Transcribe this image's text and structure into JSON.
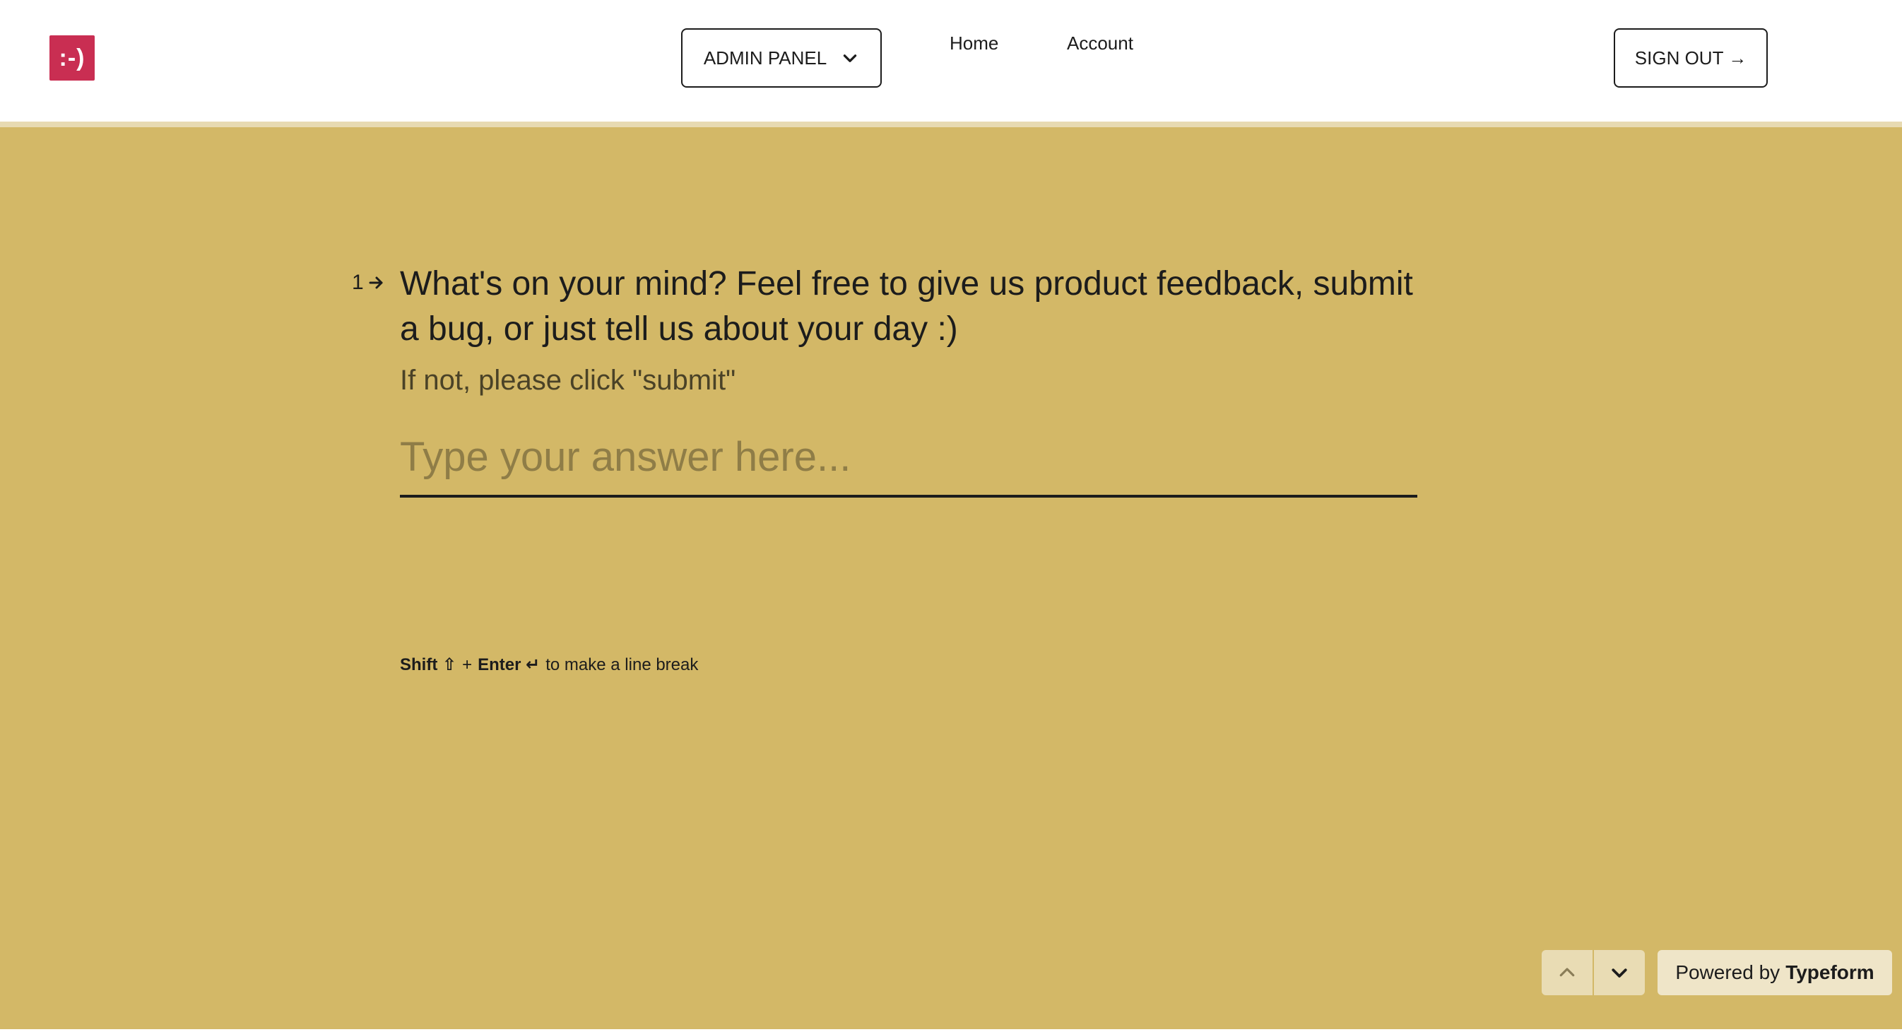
{
  "header": {
    "logo_text": ":-)",
    "admin_panel_label": "ADMIN PANEL",
    "nav": [
      {
        "label": "Home"
      },
      {
        "label": "Account"
      }
    ],
    "sign_out_label": "SIGN OUT →"
  },
  "question": {
    "number": "1",
    "title": "What's on your mind? Feel free to give us product feedback, submit a bug, or just tell us about your day :)",
    "description": "If not, please click \"submit\"",
    "answer_value": "",
    "answer_placeholder": "Type your answer here...",
    "hint": {
      "shift_label": "Shift ⇧",
      "plus": "+",
      "enter_label": "Enter ↵",
      "suffix": "to make a line break"
    }
  },
  "footer": {
    "powered_prefix": "Powered by",
    "powered_brand": "Typeform"
  },
  "colors": {
    "background": "#d3b867",
    "logo": "#c92e52",
    "text": "#1c1c1c"
  },
  "icons": {
    "admin_chevron": "chevron-down-icon",
    "question_arrow": "arrow-right-icon",
    "nav_up": "chevron-up-icon",
    "nav_down": "chevron-down-icon"
  }
}
